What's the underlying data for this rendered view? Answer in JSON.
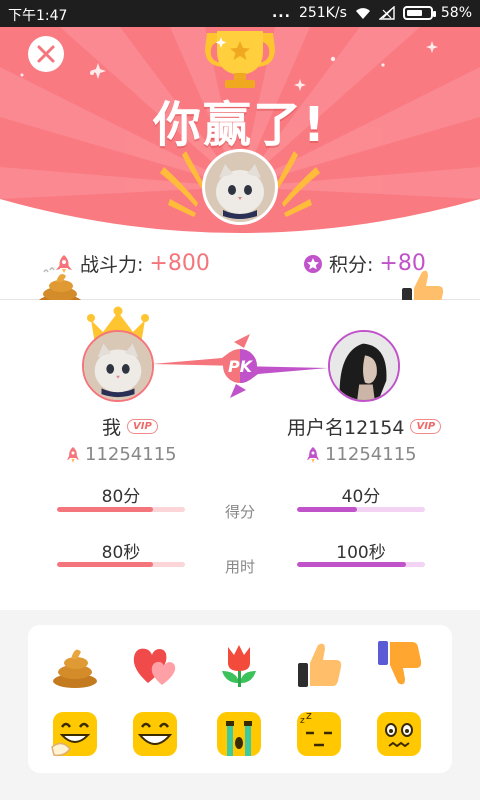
{
  "status_bar": {
    "time": "下午1:47",
    "dots": "...",
    "speed": "251K/s",
    "battery": "58%",
    "battery_level": 0.58
  },
  "header": {
    "title": "你赢了!",
    "close_icon": "close-icon",
    "trophy_icon": "trophy-icon",
    "bg_color": "#fa7a82"
  },
  "stats": {
    "power_label": "战斗力:",
    "power_value": "+800",
    "points_label": "积分:",
    "points_value": "+80"
  },
  "players": {
    "me": {
      "name": "我",
      "vip": "VIP",
      "id": "11254115",
      "score": "80分",
      "score_fraction": 0.75,
      "time": "80秒",
      "time_fraction": 0.75
    },
    "opponent": {
      "name": "用户名12154",
      "vip": "VIP",
      "id": "11254115",
      "score": "40分",
      "score_fraction": 0.47,
      "time": "100秒",
      "time_fraction": 0.85
    }
  },
  "metric_labels": {
    "score": "得分",
    "time": "用时"
  },
  "pk_label": "PK",
  "colors": {
    "accent_red": "#f4757b",
    "accent_purple": "#c053c9"
  },
  "emojis": [
    "poop-icon",
    "hearts-icon",
    "flower-icon",
    "thumbs-up-icon",
    "thumbs-down-icon",
    "laughing-face-icon",
    "grinning-face-icon",
    "crying-face-icon",
    "sleeping-face-icon",
    "worried-face-icon"
  ]
}
